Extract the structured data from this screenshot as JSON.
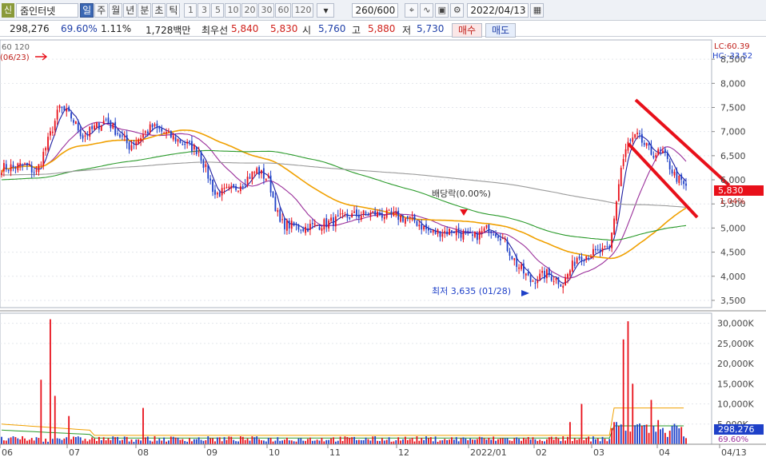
{
  "toolbar": {
    "badge": "신",
    "stock_name": "줌인터넷",
    "periods": [
      "일",
      "주",
      "월",
      "년",
      "분",
      "초",
      "틱"
    ],
    "active_period": "일",
    "intervals": [
      "1",
      "3",
      "5",
      "10",
      "20",
      "30",
      "60",
      "120"
    ],
    "count": "260/600",
    "date": "2022/04/13"
  },
  "info": {
    "volume": "298,276",
    "turnover": "69.60%",
    "ratio": "1.11%",
    "amount": "1,728백만",
    "best_label": "최우선",
    "best_ask": "5,840",
    "best_bid": "5,830",
    "open_label": "시",
    "open": "5,760",
    "high_label": "고",
    "high": "5,880",
    "low_label": "저",
    "low": "5,730",
    "buy_label": "매수",
    "sell_label": "매도"
  },
  "chart_data": {
    "type": "candlestick",
    "ma_legend": "60  120",
    "top_label": "(06/23)",
    "lc_label": "LC:60.39",
    "hc_label": "HC:-33.52",
    "price_ticks": [
      "8,500",
      "8,000",
      "7,500",
      "7,000",
      "6,500",
      "6,000",
      "5,500",
      "5,000",
      "4,500",
      "4,000",
      "3,500"
    ],
    "price_ylim": [
      3350,
      8900
    ],
    "current_price": "5,830",
    "current_change": "1.04%",
    "dividend_label": "배당락(0.00%)",
    "low_annotation": "최저 3,635 (01/28)",
    "low_value": 3635,
    "volume_ticks": [
      "30,000K",
      "25,000K",
      "20,000K",
      "15,000K",
      "10,000K",
      "5,000K"
    ],
    "volume_ylim": [
      0,
      32500
    ],
    "volume_current": "298,276",
    "volume_ratio": "69.60%",
    "x_labels": [
      "06",
      "07",
      "08",
      "09",
      "10",
      "11",
      "12",
      "2022/01",
      "02",
      "03",
      "04",
      "04/13"
    ],
    "candles": {
      "n": 254,
      "anchors": [
        [
          0,
          6250
        ],
        [
          10,
          6300
        ],
        [
          15,
          6150
        ],
        [
          20,
          6800
        ],
        [
          25,
          7500
        ],
        [
          30,
          7300
        ],
        [
          35,
          6900
        ],
        [
          45,
          7250
        ],
        [
          55,
          6700
        ],
        [
          65,
          7100
        ],
        [
          75,
          6850
        ],
        [
          85,
          6600
        ],
        [
          92,
          5700
        ],
        [
          100,
          5800
        ],
        [
          110,
          6200
        ],
        [
          115,
          6000
        ],
        [
          120,
          5100
        ],
        [
          130,
          5000
        ],
        [
          140,
          5100
        ],
        [
          150,
          5250
        ],
        [
          160,
          5300
        ],
        [
          170,
          5250
        ],
        [
          178,
          5150
        ],
        [
          185,
          4900
        ],
        [
          195,
          4950
        ],
        [
          203,
          4800
        ],
        [
          210,
          5000
        ],
        [
          215,
          4850
        ],
        [
          222,
          4250
        ],
        [
          228,
          3900
        ],
        [
          235,
          4050
        ],
        [
          242,
          3850
        ],
        [
          248,
          4400
        ],
        [
          258,
          4500
        ],
        [
          262,
          4550
        ],
        [
          267,
          6250
        ],
        [
          270,
          6750
        ],
        [
          274,
          6900
        ],
        [
          280,
          6550
        ],
        [
          285,
          6550
        ],
        [
          290,
          6100
        ],
        [
          295,
          5830
        ]
      ]
    },
    "moving_averages": [
      {
        "name": "MA5",
        "color": "#1e1ea0"
      },
      {
        "name": "MA20",
        "color": "#9a2f9a"
      },
      {
        "name": "MA60",
        "color": "#f0a000"
      },
      {
        "name": "MA120",
        "color": "#2a9a2a"
      },
      {
        "name": "MA240",
        "color": "#9a9a9a"
      }
    ],
    "volume_spikes": [
      [
        17,
        16000
      ],
      [
        21,
        31000
      ],
      [
        23,
        12000
      ],
      [
        61,
        9000
      ],
      [
        29,
        7000
      ],
      [
        270,
        30500
      ],
      [
        268,
        26000
      ],
      [
        272,
        15000
      ],
      [
        250,
        10000
      ],
      [
        245,
        5500
      ],
      [
        280,
        11000
      ],
      [
        283,
        6000
      ],
      [
        265,
        5500
      ]
    ],
    "trend_lines": {
      "color": "#e8101a"
    },
    "colors": {
      "up": "#e8101a",
      "down": "#1e40c8",
      "grid": "#e3e6ec",
      "axis": "#aeb4c0"
    }
  }
}
